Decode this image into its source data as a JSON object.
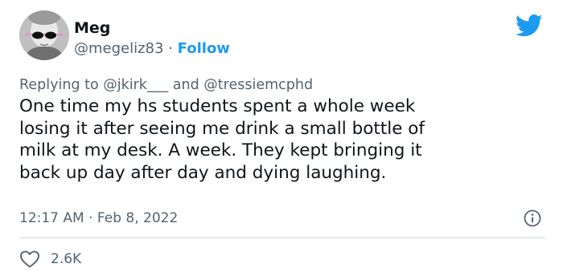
{
  "author": {
    "display_name": "Meg",
    "handle": "@megeliz83",
    "separator": "·",
    "follow_label": "Follow",
    "avatar_icon": "sunglasses-portrait-avatar"
  },
  "header": {
    "platform_icon": "twitter-bird-icon",
    "brand_color": "#1d9bf0"
  },
  "reply_context": {
    "prefix": "Replying to",
    "mention_1": "@jkirk___",
    "conjunction": "and",
    "mention_2": "@tressiemcphd"
  },
  "tweet": {
    "lines": [
      "One time my hs students spent a whole week",
      "losing it after seeing me drink a small bottle of",
      "milk at my desk. A week. They kept bringing it",
      "back up day after day and dying laughing."
    ]
  },
  "meta": {
    "time": "12:17 AM",
    "separator": "·",
    "date": "Feb 8, 2022",
    "info_icon": "info-icon"
  },
  "engagement": {
    "like_icon": "heart-outline-icon",
    "likes": "2.6K"
  }
}
